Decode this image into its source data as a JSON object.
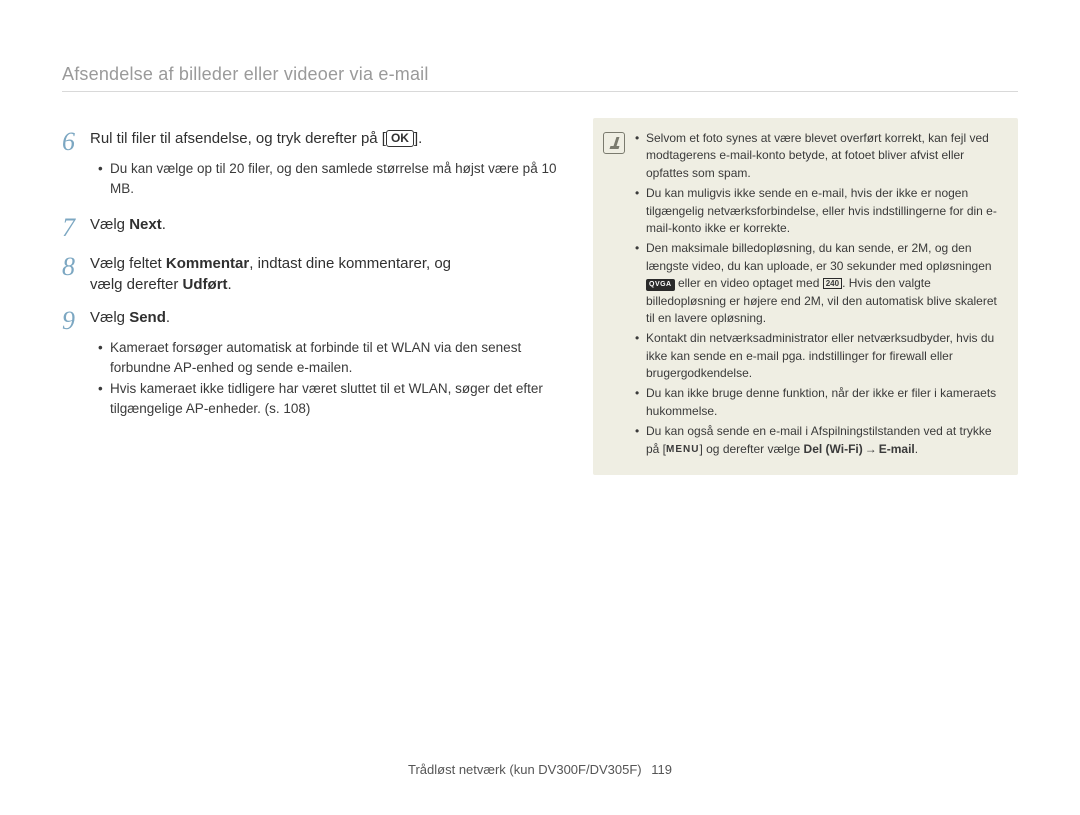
{
  "header": {
    "title": "Afsendelse af billeder eller videoer via e-mail"
  },
  "steps": {
    "six": {
      "num": "6",
      "text_pre": "Rul til filer til afsendelse, og tryk derefter på [",
      "ok": "OK",
      "text_post": "].",
      "bullets": [
        "Du kan vælge op til 20 filer, og den samlede størrelse må højst være på 10 MB."
      ]
    },
    "seven": {
      "num": "7",
      "text_pre": "Vælg ",
      "bold": "Next",
      "text_post": "."
    },
    "eight": {
      "num": "8",
      "line1_pre": "Vælg feltet ",
      "line1_bold": "Kommentar",
      "line1_post": ", indtast dine kommentarer, og",
      "line2_pre": "vælg derefter ",
      "line2_bold": "Udført",
      "line2_post": "."
    },
    "nine": {
      "num": "9",
      "text_pre": "Vælg ",
      "bold": "Send",
      "text_post": ".",
      "bullets": [
        "Kameraet forsøger automatisk at forbinde til et WLAN via den senest forbundne AP-enhed og sende e-mailen.",
        "Hvis kameraet ikke tidligere har været sluttet til et WLAN, søger det efter tilgængelige AP-enheder. (s. 108)"
      ]
    }
  },
  "notes": {
    "items": [
      {
        "text": "Selvom et foto synes at være blevet overført korrekt, kan fejl ved modtagerens e-mail-konto betyde, at fotoet bliver afvist eller opfattes som spam."
      },
      {
        "text": "Du kan muligvis ikke sende en e-mail, hvis der ikke er nogen tilgængelig netværksforbindelse, eller hvis indstillingerne for din e-mail-konto ikke er korrekte."
      },
      {
        "text_pre": "Den maksimale billedopløsning, du kan sende, er 2M, og den længste video, du kan uploade, er 30 sekunder med opløsningen ",
        "badge1": "QVGA",
        "text_mid": " eller en video optaget med ",
        "badge2": "240",
        "text_post": ". Hvis den valgte billedopløsning er højere end 2M, vil den automatisk blive skaleret til en lavere opløsning."
      },
      {
        "text": "Kontakt din netværksadministrator eller netværksudbyder, hvis du ikke kan sende en e-mail pga. indstillinger for firewall eller brugergodkendelse."
      },
      {
        "text": "Du kan ikke bruge denne funktion, når der ikke er filer i kameraets hukommelse."
      },
      {
        "text_pre": "Du kan også sende en e-mail i Afspilningstilstanden ved at trykke på [",
        "menu": "MENU",
        "text_mid": "] og derefter vælge ",
        "bold": "Del (Wi-Fi)",
        "arrow": " → ",
        "bold2": "E-mail",
        "text_post": "."
      }
    ]
  },
  "footer": {
    "label": "Trådløst netværk (kun DV300F/DV305F)",
    "page": "119"
  }
}
